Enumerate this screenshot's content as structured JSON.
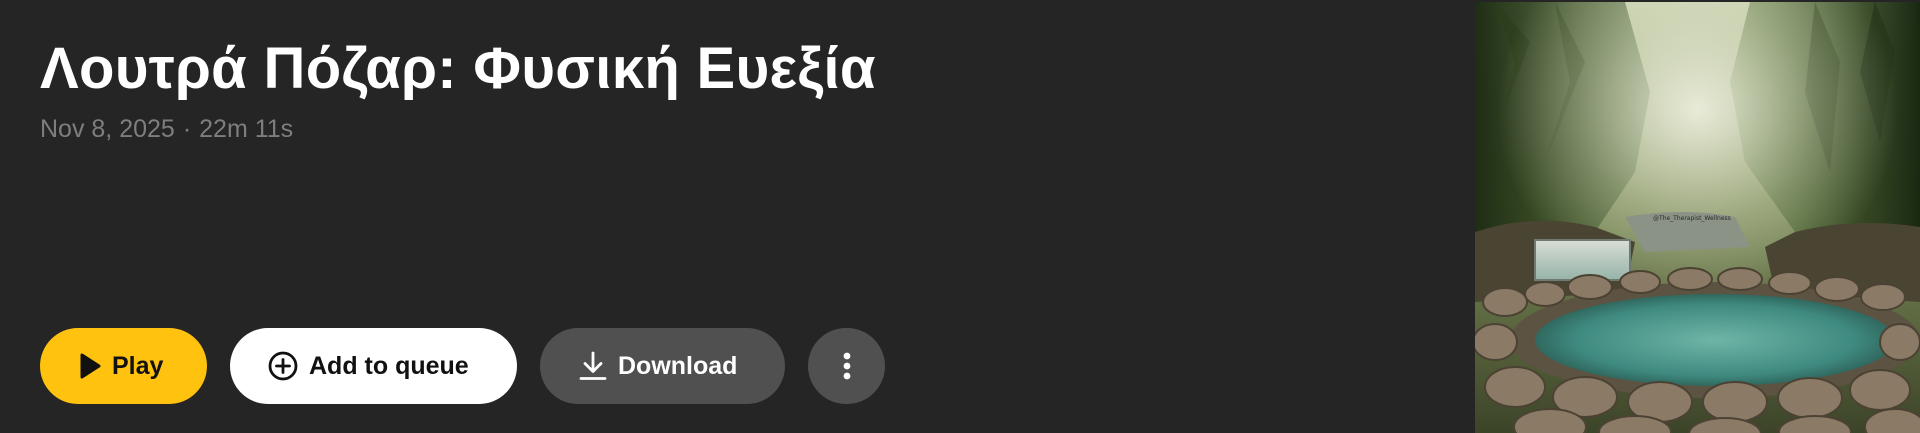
{
  "episode": {
    "title": "Λουτρά Πόζαρ: Φυσική Ευεξία",
    "date": "Nov 8, 2025",
    "separator": "·",
    "duration": "22m 11s"
  },
  "actions": {
    "play_label": "Play",
    "queue_label": "Add to queue",
    "download_label": "Download"
  },
  "artwork": {
    "watermark": "@The_Therapist_Wellness"
  },
  "icons": {
    "play": "play-icon",
    "queue": "add-circle-icon",
    "download": "download-icon",
    "more": "more-vertical-icon"
  },
  "colors": {
    "background": "#252525",
    "play_button": "#ffc20f",
    "queue_button": "#ffffff",
    "secondary_button": "#505050",
    "title": "#ffffff",
    "meta": "#7e7e7e"
  }
}
